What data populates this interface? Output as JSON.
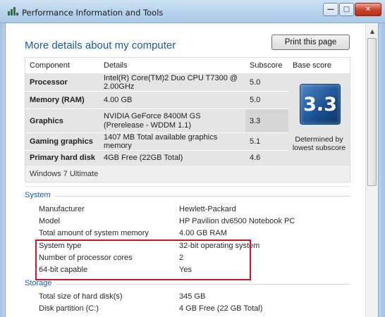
{
  "window": {
    "title": "Performance Information and Tools",
    "buttons": {
      "minimize": "—",
      "maximize": "□",
      "close": "✕"
    }
  },
  "header": {
    "title": "More details about my computer",
    "print_button": "Print this page"
  },
  "score_table": {
    "headers": [
      "Component",
      "Details",
      "Subscore",
      "Base score"
    ],
    "rows": [
      {
        "component": "Processor",
        "details": "Intel(R) Core(TM)2 Duo CPU T7300 @ 2.00GHz",
        "subscore": "5.0"
      },
      {
        "component": "Memory (RAM)",
        "details": "4.00 GB",
        "subscore": "5.0"
      },
      {
        "component": "Graphics",
        "details": "NVIDIA GeForce 8400M GS (Prerelease - WDDM 1.1)",
        "subscore": "3.3"
      },
      {
        "component": "Gaming graphics",
        "details": "1407 MB Total available graphics memory",
        "subscore": "5.1"
      },
      {
        "component": "Primary hard disk",
        "details": "4GB Free (22GB Total)",
        "subscore": "4.6"
      }
    ],
    "base_score": "3.3",
    "base_score_caption": "Determined by lowest subscore",
    "os": "Windows 7 Ultimate"
  },
  "system": {
    "title": "System",
    "rows": [
      {
        "label": "Manufacturer",
        "value": "Hewlett-Packard"
      },
      {
        "label": "Model",
        "value": "HP Pavilion dv6500 Notebook PC"
      },
      {
        "label": "Total amount of system memory",
        "value": "4.00 GB RAM"
      },
      {
        "label": "System type",
        "value": "32-bit operating system"
      },
      {
        "label": "Number of processor cores",
        "value": "2"
      },
      {
        "label": "64-bit capable",
        "value": "Yes"
      }
    ]
  },
  "storage": {
    "title": "Storage",
    "rows": [
      {
        "label": "Total size of hard disk(s)",
        "value": "345 GB"
      },
      {
        "label": "Disk partition (C:)",
        "value": "4 GB Free (22 GB Total)"
      }
    ]
  },
  "colors": {
    "accent": "#1e5aa5",
    "highlight_border": "#d2132a",
    "score_tile": "#1a4e8f"
  }
}
